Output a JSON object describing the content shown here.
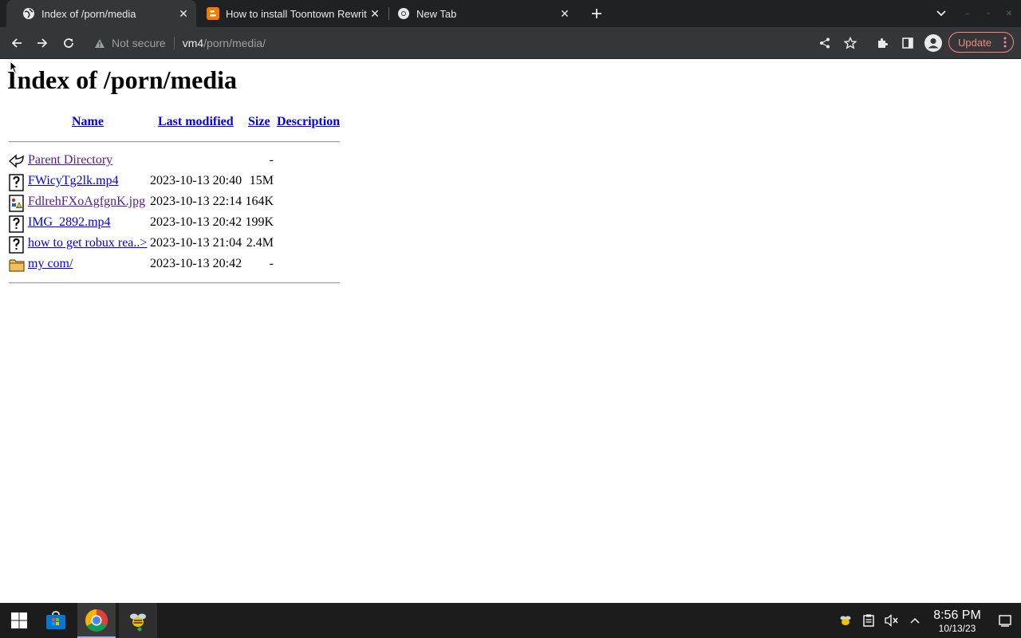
{
  "browser": {
    "tabs": [
      {
        "title": "Index of /porn/media",
        "favicon": "globe-icon",
        "active": true
      },
      {
        "title": "How to install Toontown Rewritten",
        "favicon": "blogger-icon",
        "active": false
      },
      {
        "title": "New Tab",
        "favicon": "chrome-icon",
        "active": false
      }
    ],
    "omnibox": {
      "security_label": "Not secure",
      "url_host": "vm4",
      "url_path": "/porn/media/"
    },
    "update_label": "Update",
    "colors": {
      "chrome_dark": "#202124",
      "toolbar": "#35363a",
      "update_accent": "#f28b82"
    }
  },
  "page": {
    "title": "Index of /porn/media",
    "columns": {
      "name": "Name",
      "last_modified": "Last modified",
      "size": "Size",
      "description": "Description"
    },
    "entries": [
      {
        "icon": "back-arrow-icon",
        "name": "Parent Directory",
        "date": "",
        "size": "-",
        "visited": true
      },
      {
        "icon": "unknown-file-icon",
        "name": "FWicyTg2lk.mp4",
        "date": "2023-10-13 20:40",
        "size": "15M",
        "visited": false
      },
      {
        "icon": "image-file-icon",
        "name": "FdlrehFXoAgfgnK.jpg",
        "date": "2023-10-13 22:14",
        "size": "164K",
        "visited": true
      },
      {
        "icon": "unknown-file-icon",
        "name": "IMG_2892.mp4",
        "date": "2023-10-13 20:42",
        "size": "199K",
        "visited": false
      },
      {
        "icon": "unknown-file-icon",
        "name": "how to get robux rea..>",
        "date": "2023-10-13 21:04",
        "size": "2.4M",
        "visited": false
      },
      {
        "icon": "folder-icon",
        "name": "my com/",
        "date": "2023-10-13 20:42",
        "size": "-",
        "visited": false
      }
    ],
    "colors": {
      "link": "#0000ee",
      "visited_link": "#551a8b"
    }
  },
  "taskbar": {
    "apps": [
      {
        "name": "start-button",
        "icon": "windows-icon"
      },
      {
        "name": "store-app",
        "icon": "store-icon"
      },
      {
        "name": "chrome-app",
        "icon": "chrome-icon",
        "active": true
      },
      {
        "name": "bee-app",
        "icon": "bee-icon"
      }
    ],
    "tray": [
      "bee-icon",
      "clipboard-icon",
      "volume-muted-icon",
      "chevron-up-icon"
    ],
    "clock": {
      "time": "8:56 PM",
      "date": "10/13/23"
    }
  }
}
